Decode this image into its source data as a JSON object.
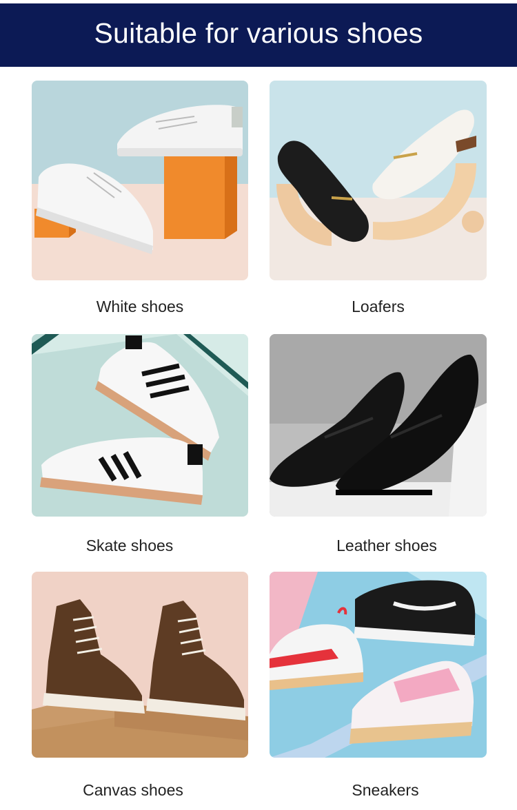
{
  "header": {
    "title": "Suitable for various shoes"
  },
  "items": [
    {
      "label": "White shoes"
    },
    {
      "label": "Loafers"
    },
    {
      "label": "Skate shoes"
    },
    {
      "label": "Leather shoes"
    },
    {
      "label": "Canvas shoes"
    },
    {
      "label": "Sneakers"
    }
  ],
  "colors": {
    "banner": "#0c1a55",
    "banner_text": "#ffffff",
    "caption_text": "#222222"
  }
}
